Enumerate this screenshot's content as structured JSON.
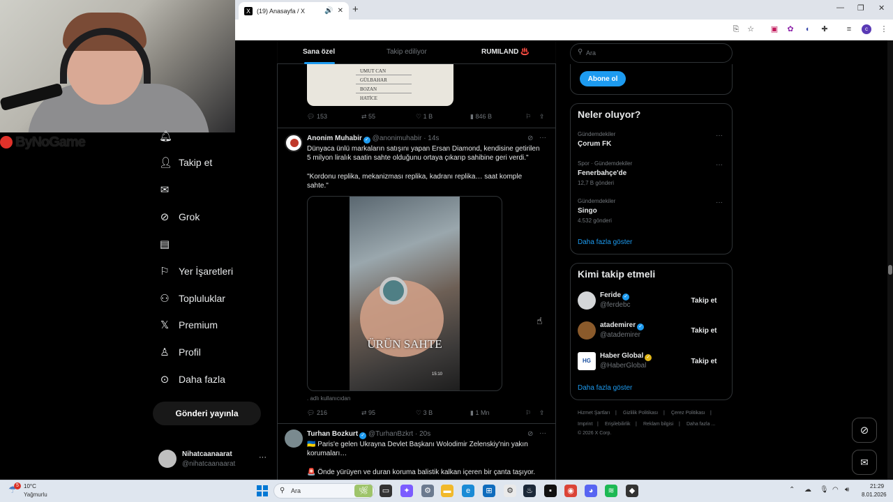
{
  "browser": {
    "tab_title": "(19) Anasayfa / X",
    "favicon": "X",
    "new_tab": "+",
    "win_min": "—",
    "win_max": "❐",
    "win_close": "✕",
    "profile_initial": "c"
  },
  "stream_logo": "ByNoGame",
  "nav": {
    "items": [
      {
        "label": "Takip et",
        "icon": "add-person-icon"
      },
      {
        "label": "",
        "icon": "mail-icon"
      },
      {
        "label": "Grok",
        "icon": "grok-icon"
      },
      {
        "label": "",
        "icon": "list-icon"
      },
      {
        "label": "Yer İşaretleri",
        "icon": "bookmark-icon"
      },
      {
        "label": "Topluluklar",
        "icon": "communities-icon"
      },
      {
        "label": "Premium",
        "icon": "x-logo-icon"
      },
      {
        "label": "Profil",
        "icon": "profile-icon"
      },
      {
        "label": "Daha fazla",
        "icon": "more-circle-icon"
      }
    ],
    "post_button": "Gönderi yayınla",
    "account": {
      "name": "Nihatcaanaarat",
      "handle": "@nihatcaanaarat",
      "more": "···"
    }
  },
  "feed": {
    "tabs": [
      "Sana özel",
      "Takip ediliyor",
      "RUMILAND ♨️"
    ],
    "tweet1": {
      "paper_names": [
        "UMUT CAN",
        "GÜLBAHAR",
        "BOZAN",
        "HATİCE"
      ],
      "replies": "153",
      "retweets": "55",
      "likes": "1 B",
      "views": "846 B"
    },
    "tweet2": {
      "name": "Anonim Muhabir",
      "handle": "@anonimuhabir · 14s",
      "text1": "Dünyaca ünlü markaların satışını yapan Ersan Diamond, kendisine getirilen",
      "text2": "5 milyon liralık saatin sahte olduğunu ortaya çıkarıp sahibine geri verdi.\"",
      "text3": "\"Kordonu replika, mekanizması replika, kadranı replika… saat komple",
      "text4": "sahte.\"",
      "video_caption": "ÜRÜN SAHTE",
      "video_time": "15:10",
      "source": ". adlı kullanıcıdan",
      "replies": "216",
      "retweets": "95",
      "likes": "3 B",
      "views": "1 Mn"
    },
    "tweet3": {
      "name": "Turhan Bozkurt",
      "handle": "@TurhanBzkrt · 20s",
      "text1": "🇺🇦 Paris'e gelen Ukrayna Devlet Başkanı Wolodimir Zelenskiy'nin yakın",
      "text2": "korumaları…",
      "text3": "🚨 Önde yürüyen ve duran koruma balistik kalkan içeren bir çanta taşıyor."
    }
  },
  "right": {
    "search_placeholder": "Ara",
    "subscribe": "Abone ol",
    "trends_title": "Neler oluyor?",
    "trends": [
      {
        "category": "Gündemdekiler",
        "name": "Çorum FK",
        "count": ""
      },
      {
        "category": "Spor · Gündemdekiler",
        "name": "Fenerbahçe'de",
        "count": "12,7 B gönderi"
      },
      {
        "category": "Gündemdekiler",
        "name": "Singo",
        "count": "4.532 gönderi"
      }
    ],
    "show_more": "Daha fazla göster",
    "wtf_title": "Kimi takip etmeli",
    "wtf": [
      {
        "name": "Feride",
        "handle": "@ferdebc",
        "badge": "blue"
      },
      {
        "name": "atademirer",
        "handle": "@atademirer",
        "badge": "blue"
      },
      {
        "name": "Haber Global",
        "handle": "@HaberGlobal",
        "badge": "gold"
      }
    ],
    "follow": "Takip et",
    "footer": [
      "Hizmet Şartları",
      "|",
      "Gizlilik Politikası",
      "|",
      "Çerez Politikası",
      "|",
      "Imprint",
      "|",
      "Erişilebilirlik",
      "|",
      "Reklam bilgisi",
      "|",
      "Daha fazla ...",
      "© 2026 X Corp."
    ]
  },
  "taskbar": {
    "weather_badge": "5",
    "temp": "10°C",
    "weather": "Yağmurlu",
    "search": "Ara",
    "time": "21:29",
    "date": "8.01.2026"
  },
  "colors": {
    "accent": "#1d9bf0",
    "background": "#000000",
    "text": "#e7e9ea",
    "muted": "#71767b",
    "border": "#2f3336"
  }
}
